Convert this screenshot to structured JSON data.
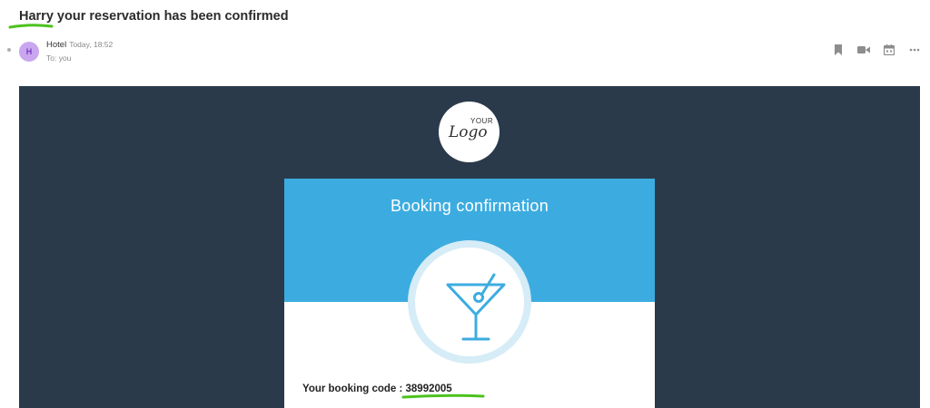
{
  "email": {
    "subject": "Harry your reservation has been confirmed",
    "sender_initial": "H",
    "sender_name": "Hotel",
    "sent_time": "Today, 18:52",
    "recipient": "To: you"
  },
  "actions": {
    "icons": [
      "bookmark-icon",
      "video-icon",
      "calendar-icon",
      "more-icon"
    ]
  },
  "body": {
    "logo_small": "YOUR",
    "logo_main": "Logo",
    "card_title": "Booking confirmation",
    "code_label": "Your booking code : ",
    "code_value": "38992005"
  },
  "colors": {
    "body_bg": "#2a3a4b",
    "card_accent": "#3cace0",
    "highlight": "#4cc21f",
    "avatar_bg": "#c9a6ef"
  }
}
